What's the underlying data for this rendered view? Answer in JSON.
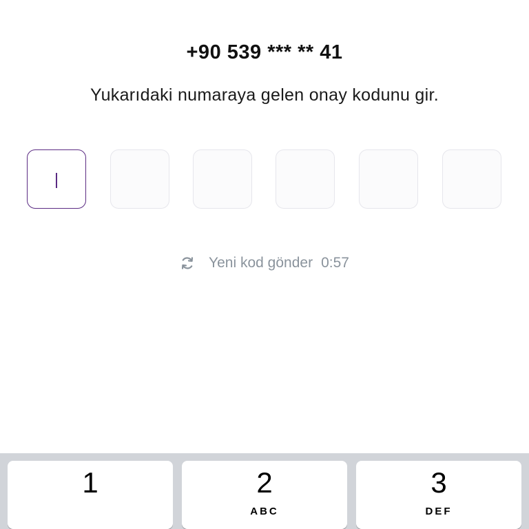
{
  "header": {
    "phone_number": "+90 539 *** ** 41",
    "instruction": "Yukarıdaki numaraya gelen onay kodunu gir."
  },
  "code_input": {
    "length": 6,
    "active_index": 0,
    "digits": [
      "",
      "",
      "",
      "",
      "",
      ""
    ]
  },
  "resend": {
    "icon": "refresh-icon",
    "label": "Yeni kod gönder",
    "timer": "0:57"
  },
  "keypad": {
    "keys": [
      {
        "number": "1",
        "letters": ""
      },
      {
        "number": "2",
        "letters": "ABC"
      },
      {
        "number": "3",
        "letters": "DEF"
      }
    ]
  },
  "colors": {
    "accent": "#5a2a82",
    "muted_text": "#8a939c",
    "keyboard_bg": "#d1d4d9"
  }
}
